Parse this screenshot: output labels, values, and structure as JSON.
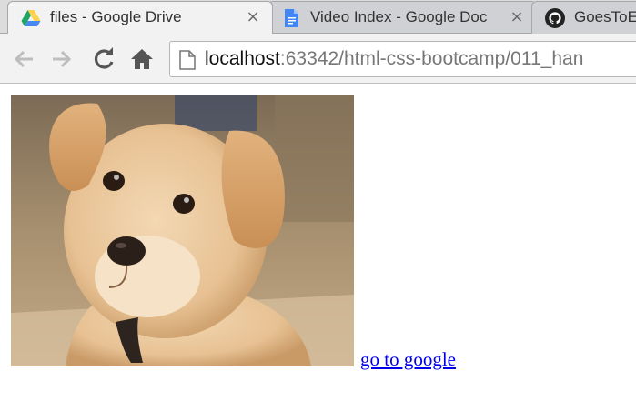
{
  "tabs": [
    {
      "title": "files - Google Drive",
      "icon": "google-drive-icon",
      "active": true
    },
    {
      "title": "Video Index - Google Doc",
      "icon": "google-docs-icon",
      "active": false
    },
    {
      "title": "GoesToE",
      "icon": "github-icon",
      "active": false
    }
  ],
  "tab_close_glyph": "×",
  "toolbar": {
    "back_icon": "back-arrow-icon",
    "forward_icon": "forward-arrow-icon",
    "reload_icon": "reload-icon",
    "home_icon": "home-icon"
  },
  "address": {
    "host": "localhost",
    "rest": ":63342/html-css-bootcamp/011_han"
  },
  "content": {
    "image_icon": "puppy-image",
    "link_text": "go to google"
  },
  "colors": {
    "link": "#0000ee",
    "drive_green": "#1fa463",
    "drive_yellow": "#ffd04b",
    "drive_blue": "#4688f4",
    "docs_blue": "#4285f4"
  }
}
